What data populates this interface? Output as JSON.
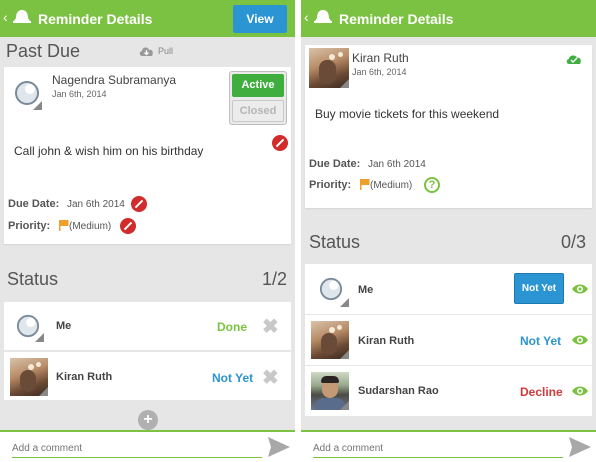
{
  "left": {
    "appbar": {
      "back": "‹",
      "title": "Reminder Details",
      "view_label": "View"
    },
    "section_title": "Past Due",
    "pull_label": "Pull",
    "owner": {
      "name": "Nagendra Subramanya",
      "date": "Jan 6th, 2014"
    },
    "active_label": "Active",
    "closed_label": "Closed",
    "message": "Call john & wish him on his birthday",
    "due_label": "Due Date:",
    "due_value": "Jan 6th 2014",
    "priority_label": "Priority:",
    "priority_value": "(Medium)",
    "status_label": "Status",
    "status_count": "1/2",
    "rows": [
      {
        "name": "Me",
        "status": "Done"
      },
      {
        "name": "Kiran  Ruth",
        "status": "Not Yet"
      }
    ],
    "add_label": "+",
    "comment_placeholder": "Add a comment"
  },
  "right": {
    "appbar": {
      "back": "‹",
      "title": "Reminder Details"
    },
    "owner": {
      "name": "Kiran  Ruth",
      "date": "Jan 6th, 2014"
    },
    "message": "Buy movie tickets for this weekend",
    "due_label": "Due Date:",
    "due_value": "Jan 6th 2014",
    "priority_label": "Priority:",
    "priority_value": "(Medium)",
    "help_label": "?",
    "status_label": "Status",
    "status_count": "0/3",
    "rows": [
      {
        "name": "Me",
        "status": "Not Yet"
      },
      {
        "name": "Kiran  Ruth",
        "status": "Not Yet"
      },
      {
        "name": "Sudarshan Rao",
        "status": "Decline"
      }
    ],
    "comment_placeholder": "Add a comment"
  },
  "colors": {
    "accent": "#7cc242",
    "blue": "#2b95d3",
    "red": "#d23a3a",
    "flag": "#f0a02a"
  },
  "icons": [
    "bell-icon",
    "cloud-download-icon",
    "cloud-check-icon",
    "block-icon",
    "flag-icon",
    "help-icon",
    "close-icon",
    "eye-icon",
    "send-icon",
    "add-icon"
  ]
}
